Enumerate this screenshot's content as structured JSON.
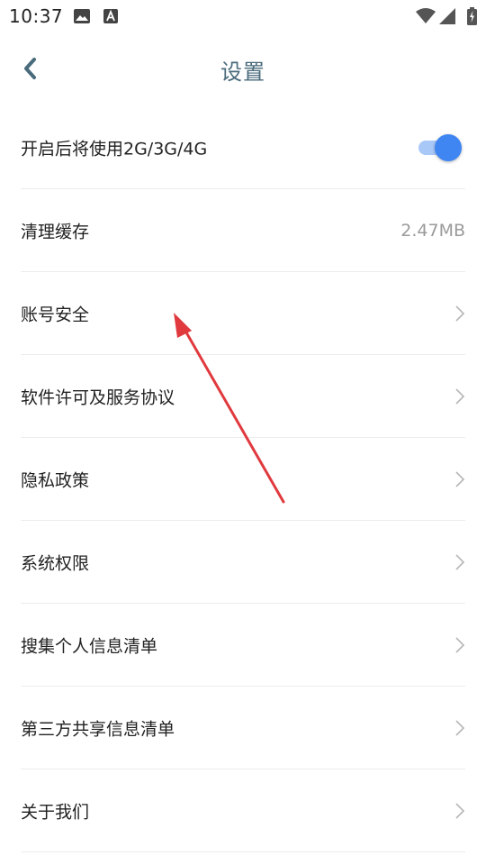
{
  "status_bar": {
    "time": "10:37",
    "left_icons": [
      "image-icon",
      "text-a-icon"
    ],
    "right_icons": [
      "wifi-icon",
      "cellular-signal-icon",
      "battery-charging-icon"
    ]
  },
  "header": {
    "back_icon": "chevron-left-icon",
    "title": "设置",
    "title_color": "#4a6b7c"
  },
  "settings": {
    "mobile_data": {
      "label": "开启后将使用2G/3G/4G",
      "enabled": true,
      "toggle_color": "#3f86f3"
    },
    "clear_cache": {
      "label": "清理缓存",
      "value": "2.47MB"
    },
    "items": [
      {
        "label": "账号安全"
      },
      {
        "label": "软件许可及服务协议"
      },
      {
        "label": "隐私政策"
      },
      {
        "label": "系统权限"
      },
      {
        "label": "搜集个人信息清单"
      },
      {
        "label": "第三方共享信息清单"
      },
      {
        "label": "关于我们"
      }
    ]
  },
  "annotation": {
    "type": "arrow",
    "color": "#e0393e",
    "points_to": "账号安全"
  }
}
